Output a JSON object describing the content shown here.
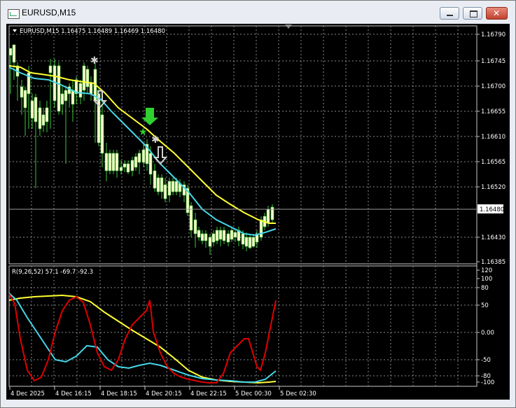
{
  "window": {
    "title": "EURUSD,M15"
  },
  "main_chart": {
    "header": "EURUSD,M15  1.16475 1.16489 1.16469 1.16480",
    "current_price_tag": "1.16480",
    "price_axis": [
      "1.16790",
      "1.16745",
      "1.16700",
      "1.16655",
      "1.16610",
      "1.16565",
      "1.16520",
      "1.16430",
      "1.16385"
    ]
  },
  "indicator": {
    "header": "R(9,26,52) 57.1 -69.7 -92.3",
    "axis": [
      "120",
      "100",
      "80",
      "50",
      "0.00",
      "-50",
      "-80",
      "-100"
    ]
  },
  "time_axis": [
    "4 Dec 2025",
    "4 Dec 16:15",
    "4 Dec 18:15",
    "4 Dec 20:15",
    "4 Dec 22:15",
    "5 Dec 00:30",
    "5 Dec 02:30"
  ],
  "colors": {
    "background": "#000000",
    "grid": "#c8c8c8",
    "bull_candle": "#ffffcc",
    "bear_candle": "#ffffcc",
    "wick": "#3cc83c",
    "ma_fast": "#44d7e8",
    "ma_slow": "#ffff33",
    "osc_fast": "#e00000",
    "osc_mid": "#44d7e8",
    "osc_slow": "#ffff33",
    "signal_buy": "#2fd02f",
    "signal_sell": "#d0d0d0"
  },
  "chart_data": {
    "type": "line",
    "series": [
      {
        "name": "EURUSD,M15",
        "open_high_low_close_last": [
          1.16475,
          1.16489,
          1.16469,
          1.1648
        ]
      }
    ]
  }
}
